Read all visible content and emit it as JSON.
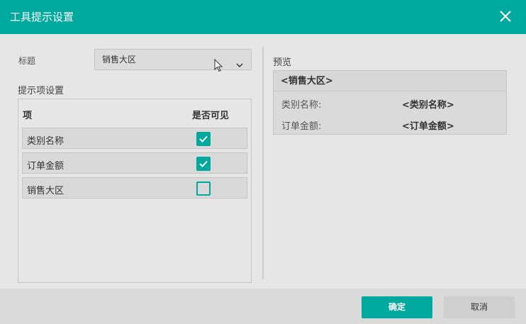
{
  "dialog": {
    "title": "工具提示设置",
    "accent_color": "#00a99d",
    "close_icon": "close-icon"
  },
  "title_field": {
    "label": "标题",
    "selected_value": "销售大区"
  },
  "settings": {
    "label": "提示项设置",
    "col_item": "项",
    "col_visible": "是否可见",
    "rows": [
      {
        "name": "类别名称",
        "visible": true
      },
      {
        "name": "订单金额",
        "visible": true
      },
      {
        "name": "销售大区",
        "visible": false
      }
    ]
  },
  "preview": {
    "label": "预览",
    "header": "<销售大区>",
    "rows": [
      {
        "key": "类别名称:",
        "value": "<类别名称>"
      },
      {
        "key": "订单金额:",
        "value": "<订单金额>"
      }
    ]
  },
  "footer": {
    "ok_label": "确定",
    "cancel_label": "取消"
  }
}
